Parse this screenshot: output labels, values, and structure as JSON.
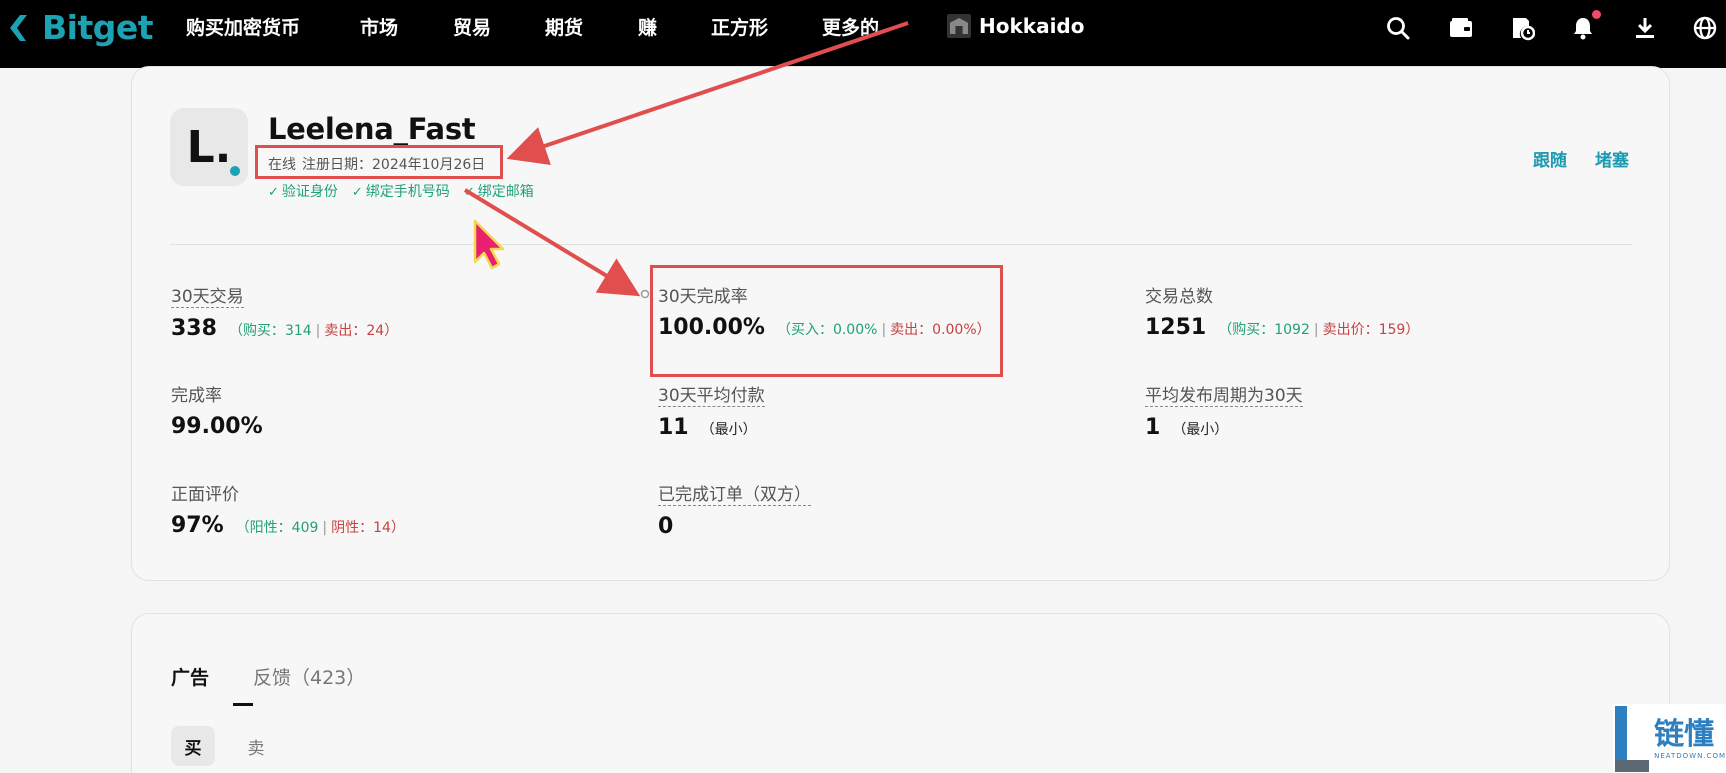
{
  "nav": {
    "logo": "Bitget",
    "items": [
      "购买加密货币",
      "市场",
      "贸易",
      "期货",
      "赚",
      "正方形",
      "更多的"
    ],
    "profile_name": "Hokkaido"
  },
  "profile": {
    "avatar_letter": "L.",
    "username": "Leelena_Fast",
    "status": "在线",
    "reg_label": "注册日期：",
    "reg_date": "2024年10月26日",
    "verifications": [
      "验证身份",
      "绑定手机号码",
      "绑定邮箱"
    ],
    "follow": "跟随",
    "block": "堵塞"
  },
  "stats": {
    "trades_30d": {
      "label": "30天交易",
      "value": "338",
      "open": "（",
      "buy_label": "购买：",
      "buy": "314",
      "sep": "|",
      "sell_label": "卖出：",
      "sell": "24",
      "close": "）"
    },
    "completion_30d": {
      "label": "30天完成率",
      "value": "100.00%",
      "open": "（",
      "buy_label": "买入：",
      "buy": "0.00%",
      "sep": "|",
      "sell_label": "卖出：",
      "sell": "0.00%",
      "close": "）"
    },
    "total_trades": {
      "label": "交易总数",
      "value": "1251",
      "open": "（",
      "buy_label": "购买：",
      "buy": "1092",
      "sep": "|",
      "sell_label": "卖出价：",
      "sell": "159",
      "close": "）"
    },
    "completion_rate": {
      "label": "完成率",
      "value": "99.00%"
    },
    "avg_pay_30d": {
      "label": "30天平均付款",
      "value": "11",
      "unit": "（最小）"
    },
    "avg_release_30d": {
      "label": "平均发布周期为30天",
      "value": "1",
      "unit": "（最小）"
    },
    "positive_rating": {
      "label": "正面评价",
      "value": "97%",
      "open": "（",
      "pos_label": "阳性：",
      "pos": "409",
      "sep": "|",
      "neg_label": "阴性：",
      "neg": "14",
      "close": "）"
    },
    "completed_orders_both": {
      "label": "已完成订单（双方）",
      "value": "0"
    }
  },
  "tabs": {
    "ads": "广告",
    "feedback": "反馈（423）"
  },
  "side": {
    "buy": "买",
    "sell": "卖"
  },
  "watermark": {
    "text": "链懂",
    "sub": "NEATDOWN.COM"
  },
  "colors": {
    "brand": "#1da2b4",
    "buy_green": "#21a07a",
    "sell_red": "#c94141",
    "highlight_red": "#e04e4e",
    "cursor_pink": "#e8206f"
  }
}
